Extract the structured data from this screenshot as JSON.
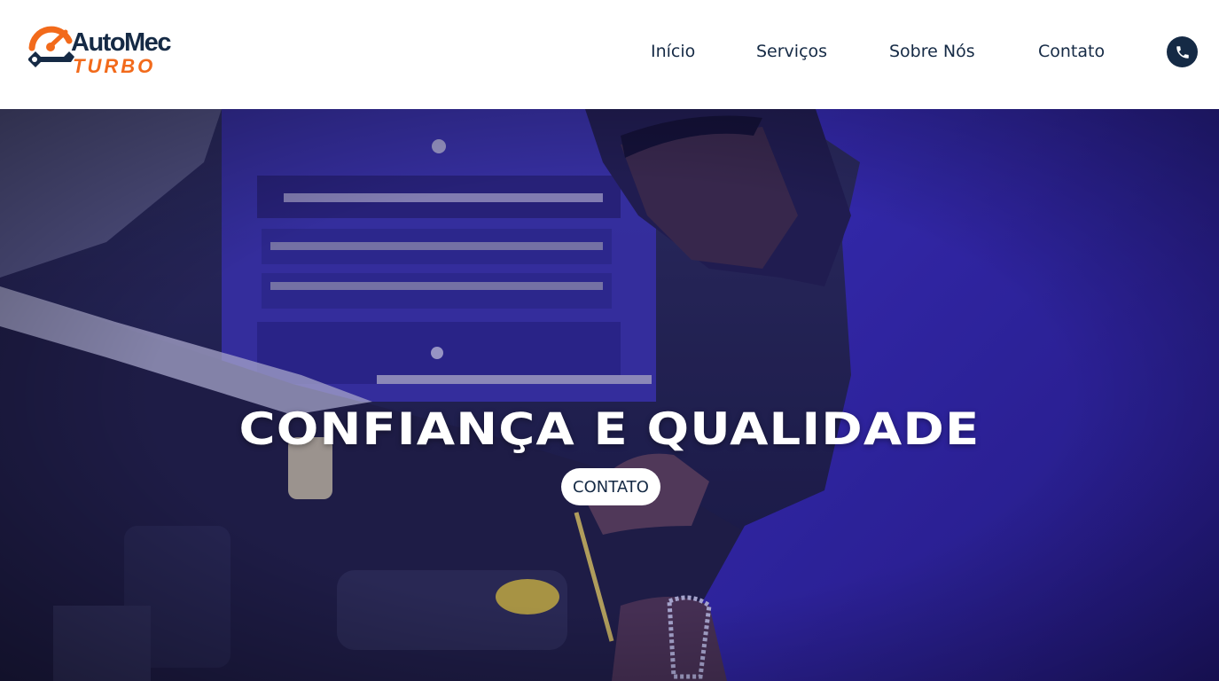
{
  "brand": {
    "name_top": "AutoMec",
    "name_bottom": "TURBO",
    "primary_color": "#152a45",
    "accent_color": "#f26a1b",
    "logo_icon": "wrench-speedometer-icon"
  },
  "nav": {
    "items": [
      {
        "label": "Início"
      },
      {
        "label": "Serviços"
      },
      {
        "label": "Sobre Nós"
      },
      {
        "label": "Contato"
      }
    ],
    "phone_icon": "phone-icon"
  },
  "hero": {
    "title": "CONFIANÇA E QUALIDADE",
    "button_label": "CONTATO",
    "image": "mechanic-working-on-car-engine",
    "overlay_color": "#2a1fa0"
  }
}
